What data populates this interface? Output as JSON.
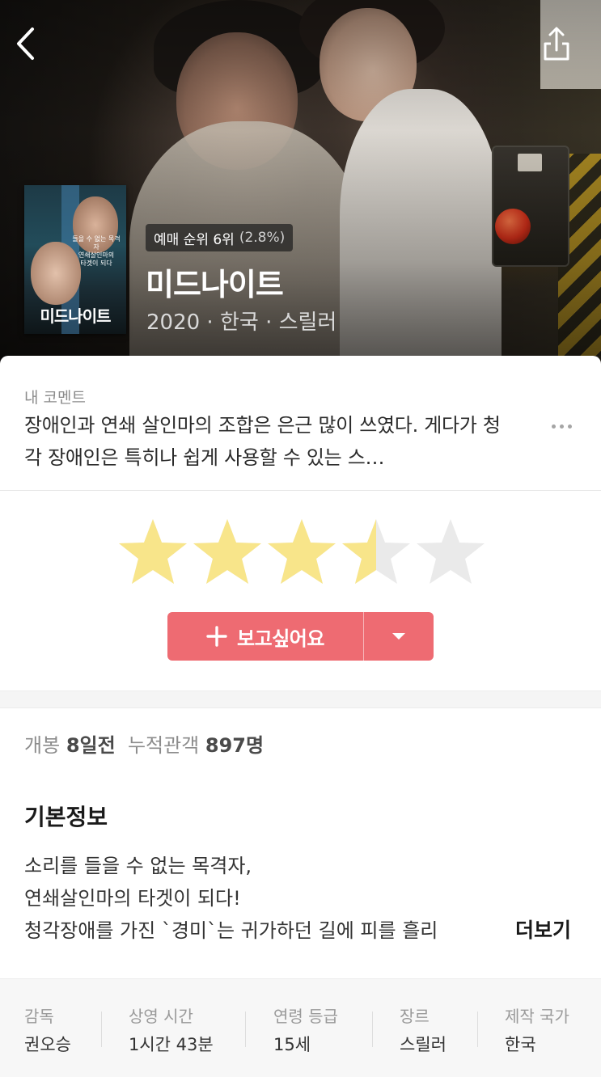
{
  "hero": {
    "rank_badge": {
      "rank_text": "예매 순위 6위",
      "pct_text": "(2.8%)"
    },
    "title": "미드나이트",
    "meta": "2020 · 한국 · 스릴러",
    "poster": {
      "title": "미드나이트",
      "tagline": "들을 수 없는 목격자\n연쇄살인마의\n타겟이 되다"
    }
  },
  "comment": {
    "label": "내 코멘트",
    "text": "장애인과 연쇄 살인마의 조합은 은근 많이 쓰였다. 게다가 청각 장애인은 특히나 쉽게 사용할 수 있는 스…"
  },
  "rating": {
    "value": 3.5,
    "max": 5,
    "colors": {
      "filled": "#f8e58a",
      "empty": "#eaeaea"
    }
  },
  "wish_button": {
    "label": "보고싶어요",
    "color": "#ee6b72"
  },
  "release": {
    "release_label": "개봉",
    "release_value": "8일전",
    "audience_label": "누적관객",
    "audience_value": "897명"
  },
  "basic_info": {
    "heading": "기본정보",
    "synopsis_lines": [
      "소리를 들을 수 없는 목격자,",
      "연쇄살인마의 타겟이 되다!",
      "청각장애를 가진 `경미`는 귀가하던 길에 피를 흘리"
    ],
    "more_label": "더보기"
  },
  "details": [
    {
      "label": "감독",
      "value": "권오승"
    },
    {
      "label": "상영 시간",
      "value": "1시간 43분"
    },
    {
      "label": "연령 등급",
      "value": "15세"
    },
    {
      "label": "장르",
      "value": "스릴러"
    },
    {
      "label": "제작 국가",
      "value": "한국"
    }
  ]
}
